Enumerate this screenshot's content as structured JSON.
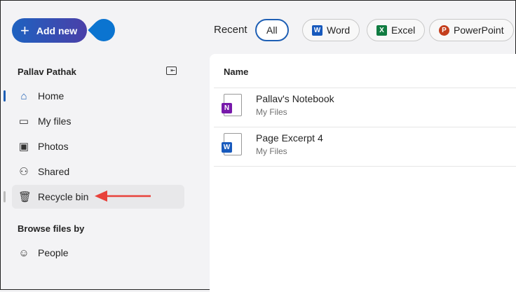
{
  "add_new": "Add new",
  "user": "Pallav Pathak",
  "nav": [
    {
      "label": "Home",
      "icon": "home-icon"
    },
    {
      "label": "My files",
      "icon": "folder-icon"
    },
    {
      "label": "Photos",
      "icon": "image-icon"
    },
    {
      "label": "Shared",
      "icon": "people-icon"
    },
    {
      "label": "Recycle bin",
      "icon": "trash-icon"
    }
  ],
  "browse_heading": "Browse files by",
  "browse": [
    {
      "label": "People",
      "icon": "person-icon"
    }
  ],
  "recent": "Recent",
  "filters": [
    "All",
    "Word",
    "Excel",
    "PowerPoint"
  ],
  "column_name": "Name",
  "files": [
    {
      "name": "Pallav's Notebook",
      "location": "My Files",
      "type": "onenote"
    },
    {
      "name": "Page Excerpt 4",
      "location": "My Files",
      "type": "word"
    }
  ],
  "colors": {
    "accent": "#1e5fb4",
    "arrow": "#e8413a"
  }
}
